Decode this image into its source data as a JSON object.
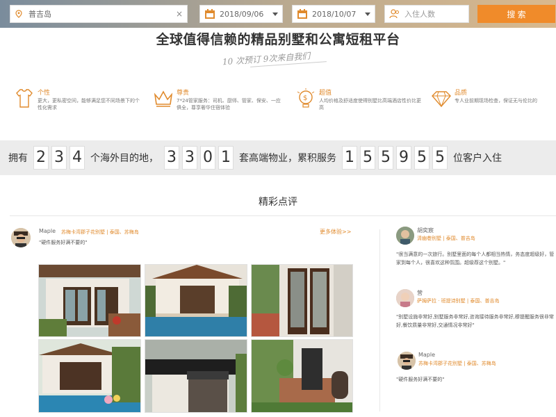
{
  "search": {
    "destination": "普吉岛",
    "checkin": "2018/09/06",
    "checkout": "2018/10/07",
    "guests_placeholder": "入住人数",
    "button_label": "搜 索"
  },
  "headline": "全球值得信赖的精品别墅和公寓短租平台",
  "slogan": "10 次预订 9次来自我们",
  "features": [
    {
      "title": "个性",
      "desc": "更大，更私密空间，能够满足您不同场景下的个性化需求"
    },
    {
      "title": "尊贵",
      "desc": "7*24管家服务：司机、厨师、管家、保安、一应俱全，尊享奢华住宿体验"
    },
    {
      "title": "超值",
      "desc": "人均价格及舒适度使得别墅比高端酒店性价比更高"
    },
    {
      "title": "品质",
      "desc": "专人业前期现场检查，保证无与伦比的"
    }
  ],
  "stats": {
    "prefix": "拥有",
    "destinations": [
      "2",
      "3",
      "4"
    ],
    "destinations_label": "个海外目的地，",
    "properties": [
      "3",
      "3",
      "0",
      "1"
    ],
    "properties_label": "套高端物业，累积服务",
    "customers": [
      "1",
      "5",
      "5",
      "9",
      "5",
      "5"
    ],
    "customers_label": "位客户入住"
  },
  "reviews_title": "精彩点评",
  "main_review": {
    "name": "Maple",
    "tag": "苏梅卡湾郡子花别墅 | 泰国、苏梅岛",
    "quote": "\"硬件服务好满不要的\"",
    "more": "更多体验>>"
  },
  "side_reviews": [
    {
      "name": "胡奕宸",
      "tag": "清幽巷别墅 | 泰国、普吉岛",
      "text": "\"很当满意的一次旅行。别墅里面的每个人都相当热情，务态度超级好，管家到每个人，很喜欢这种氛围。超级荐这个别墅。\""
    },
    {
      "name": "营",
      "tag": "萨姆萨拉 · 班提诗别墅 | 泰国、普吉岛",
      "text": "\"别墅设施非常好,别墅服务非常好,咨询接待服务非常好,穆提醒服务很非常好,餐饮质量非常好,交通情况非常好\""
    },
    {
      "name": "Maple",
      "tag": "苏梅卡湾郡子花别墅 | 泰国、苏梅岛",
      "text": "\"硬件服务好满不要的\""
    }
  ],
  "colors": {
    "accent": "#f08b2a",
    "feature_title": "#e08a2c",
    "stats_band": "#ececec"
  }
}
